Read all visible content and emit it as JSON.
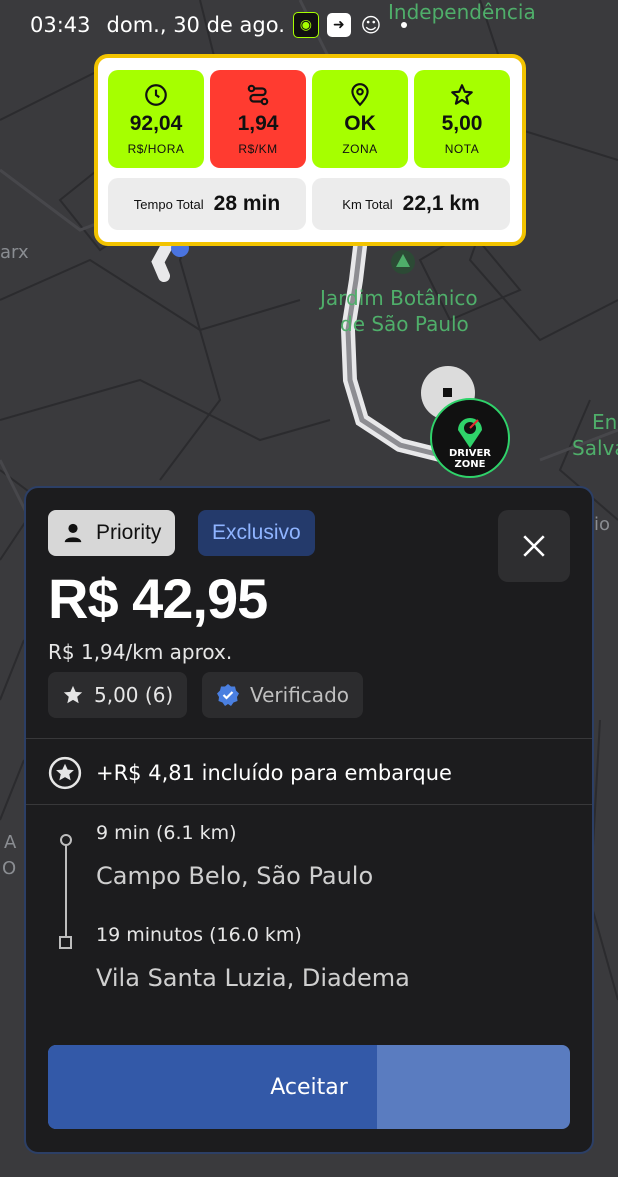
{
  "status_bar": {
    "time": "03:43",
    "date": "dom., 30 de ago."
  },
  "map": {
    "labels": {
      "independencia": "Independência",
      "jardim_line1": "Jardim Botânico",
      "jardim_line2": "de São Paulo",
      "left_partial": "arx",
      "right_en": "En",
      "right_salva": "Salva",
      "right_io": "io",
      "left_a": "A",
      "left_o": "O"
    },
    "driver_zone_logo": "DRIVER ZONE"
  },
  "stats": {
    "tiles": [
      {
        "icon": "clock-icon",
        "value": "92,04",
        "label": "R$/HORA",
        "color": "#a6ff00"
      },
      {
        "icon": "route-icon",
        "value": "1,94",
        "label": "R$/KM",
        "color": "#ff3b30"
      },
      {
        "icon": "map-pin-icon",
        "value": "OK",
        "label": "ZONA",
        "color": "#a6ff00"
      },
      {
        "icon": "star-icon",
        "value": "5,00",
        "label": "NOTA",
        "color": "#a6ff00"
      }
    ],
    "tempo_total_label": "Tempo Total",
    "tempo_total_value": "28 min",
    "km_total_label": "Km Total",
    "km_total_value": "22,1 km",
    "border_color": "#f2c300"
  },
  "offer": {
    "priority_label": "Priority",
    "exclusivo_label": "Exclusivo",
    "price": "R$ 42,95",
    "per_km": "R$ 1,94/km aprox.",
    "rating": "5,00 (6)",
    "verified_label": "Verificado",
    "bonus": "+R$ 4,81 incluído para embarque",
    "pickup_time": "9 min (6.1 km)",
    "pickup_place": "Campo Belo, São Paulo",
    "dropoff_time": "19 minutos (16.0 km)",
    "dropoff_place": "Vila Santa Luzia, Diadema",
    "accept_label": "Aceitar",
    "accept_progress": 0.63,
    "accent_color": "#3359a8"
  }
}
